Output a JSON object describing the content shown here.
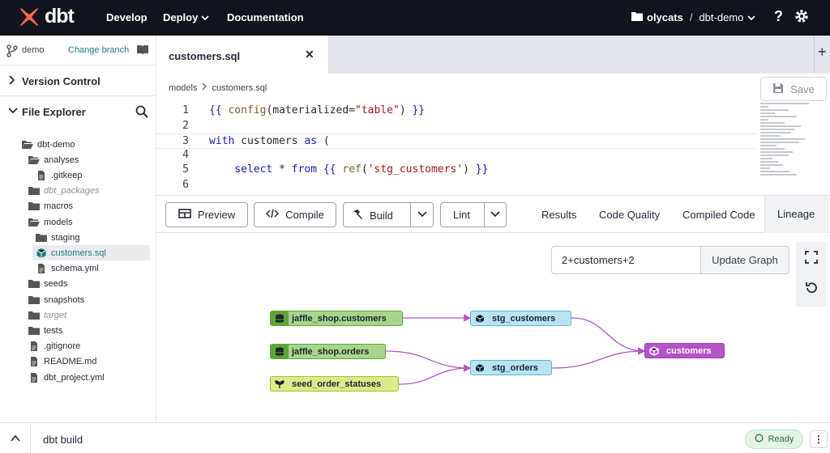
{
  "topbar": {
    "logo_text": "dbt",
    "nav": {
      "develop": "Develop",
      "deploy": "Deploy",
      "docs": "Documentation"
    },
    "account": "olycats",
    "separator": "/",
    "project": "dbt-demo",
    "help": "?"
  },
  "sidebar": {
    "branch": "demo",
    "change_branch": "Change branch",
    "version_control": "Version Control",
    "file_explorer": "File Explorer",
    "tree": [
      {
        "label": "dbt-demo",
        "type": "folder-open",
        "muted": false,
        "selected": false
      },
      {
        "label": "analyses",
        "type": "folder-open",
        "muted": false,
        "selected": false
      },
      {
        "label": ".gitkeep",
        "type": "file",
        "muted": false,
        "selected": false
      },
      {
        "label": "dbt_packages",
        "type": "folder",
        "muted": true,
        "selected": false
      },
      {
        "label": "macros",
        "type": "folder",
        "muted": false,
        "selected": false
      },
      {
        "label": "models",
        "type": "folder-open",
        "muted": false,
        "selected": false
      },
      {
        "label": "staging",
        "type": "folder",
        "muted": false,
        "selected": false
      },
      {
        "label": "customers.sql",
        "type": "model",
        "muted": false,
        "selected": true
      },
      {
        "label": "schema.yml",
        "type": "file",
        "muted": false,
        "selected": false
      },
      {
        "label": "seeds",
        "type": "folder",
        "muted": false,
        "selected": false
      },
      {
        "label": "snapshots",
        "type": "folder",
        "muted": false,
        "selected": false
      },
      {
        "label": "target",
        "type": "folder",
        "muted": true,
        "selected": false
      },
      {
        "label": "tests",
        "type": "folder",
        "muted": false,
        "selected": false
      },
      {
        "label": ".gitignore",
        "type": "file",
        "muted": false,
        "selected": false
      },
      {
        "label": "README.md",
        "type": "file",
        "muted": false,
        "selected": false
      },
      {
        "label": "dbt_project.yml",
        "type": "file",
        "muted": false,
        "selected": false
      }
    ]
  },
  "editor": {
    "tab_label": "customers.sql",
    "tab_close": "✕",
    "new_tab": "+",
    "breadcrumb": [
      "models",
      "customers.sql"
    ],
    "save_label": "Save",
    "lines": [
      {
        "n": "1",
        "html": "<span class=\"tk-br\">{{</span> <span class=\"tk-fn\">config</span>(materialized=<span class=\"tk-str\">\"table\"</span>) <span class=\"tk-br\">}}</span>"
      },
      {
        "n": "2",
        "html": ""
      },
      {
        "n": "3",
        "html": "<span class=\"tk-kw\">with</span> customers <span class=\"tk-kw\">as</span> ("
      },
      {
        "n": "4",
        "html": ""
      },
      {
        "n": "5",
        "html": "    <span class=\"tk-kw\">select</span> * <span class=\"tk-kw\">from</span> <span class=\"tk-br\">{{</span> <span class=\"tk-fn\">ref</span>(<span class=\"tk-str\">'stg_customers'</span>) <span class=\"tk-br\">}}</span>"
      },
      {
        "n": "6",
        "html": ""
      }
    ]
  },
  "toolbar": {
    "preview": "Preview",
    "compile": "Compile",
    "build": "Build",
    "lint": "Lint",
    "tabs": {
      "results": "Results",
      "quality": "Code Quality",
      "compiled": "Compiled Code",
      "lineage": "Lineage"
    }
  },
  "lineage": {
    "selector": "2+customers+2",
    "update": "Update Graph",
    "nodes": {
      "jaffle_customers": "jaffle_shop.customers",
      "jaffle_orders": "jaffle_shop.orders",
      "seed_statuses": "seed_order_statuses",
      "stg_customers": "stg_customers",
      "stg_orders": "stg_orders",
      "customers": "customers"
    },
    "colors": {
      "edge": "#b454c9",
      "source": "#5fa535",
      "seed": "#a6bd2a",
      "staging": "#5bb6d8",
      "model": "#b454c9"
    }
  },
  "bottombar": {
    "command": "dbt build",
    "status": "Ready",
    "more": "⋮"
  }
}
